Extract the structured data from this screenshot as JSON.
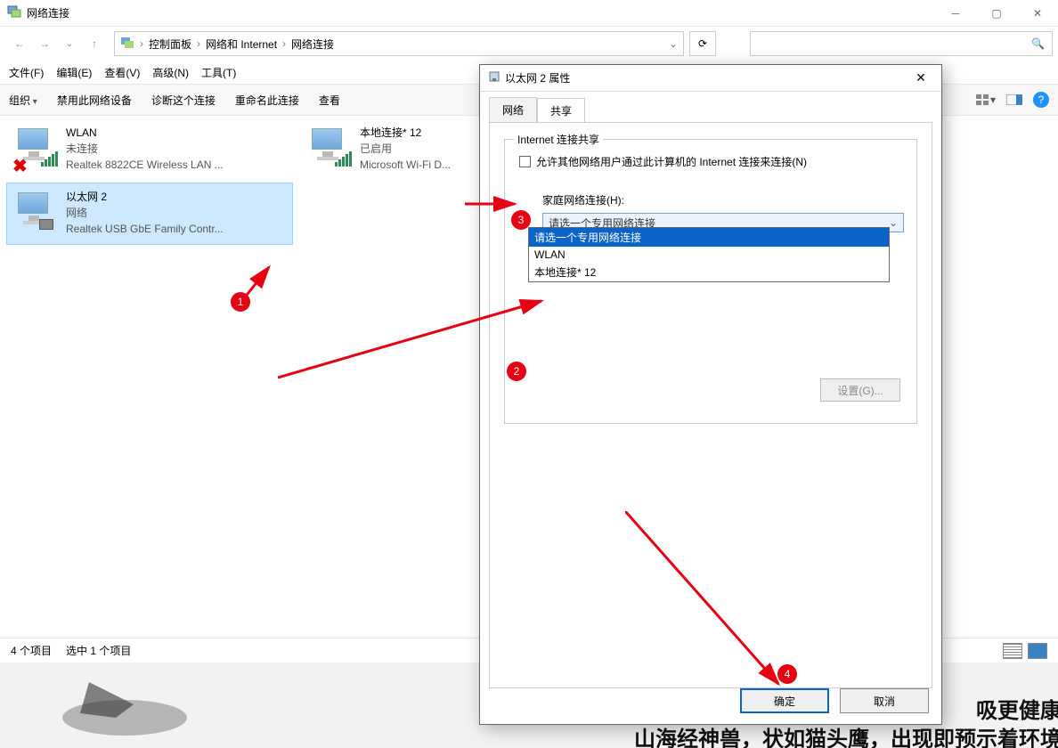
{
  "window": {
    "title": "网络连接",
    "breadcrumb": {
      "a": "控制面板",
      "b": "网络和 Internet",
      "c": "网络连接"
    },
    "menus": {
      "file": "文件(F)",
      "edit": "编辑(E)",
      "view": "查看(V)",
      "advanced": "高级(N)",
      "tools": "工具(T)"
    },
    "toolbar": {
      "organize": "组织",
      "disable": "禁用此网络设备",
      "diagnose": "诊断这个连接",
      "rename": "重命名此连接",
      "view_status": "查看"
    },
    "status": {
      "items": "4 个项目",
      "selected": "选中 1 个项目"
    }
  },
  "connections": [
    {
      "name": "WLAN",
      "status": "未连接",
      "device": "Realtek 8822CE Wireless LAN ..."
    },
    {
      "name": "本地连接* 12",
      "status": "已启用",
      "device": "Microsoft Wi-Fi D..."
    },
    {
      "name": "以太网 2",
      "status": "网络",
      "device": "Realtek USB GbE Family Contr..."
    }
  ],
  "dialog": {
    "title": "以太网 2 属性",
    "tabs": {
      "network": "网络",
      "sharing": "共享"
    },
    "fieldset": "Internet 连接共享",
    "checkbox_label": "允许其他网络用户通过此计算机的 Internet 连接来连接(N)",
    "combo_label": "家庭网络连接(H):",
    "combo_selected": "请选一个专用网络连接",
    "combo_options": {
      "o0": "请选一个专用网络连接",
      "o1": "WLAN",
      "o2": "本地连接* 12"
    },
    "settings_btn": "设置(G)...",
    "ok": "确定",
    "cancel": "取消"
  },
  "annotations": {
    "b1": "1",
    "b2": "2",
    "b3": "3",
    "b4": "4"
  },
  "bg": {
    "line1": "吸更健康",
    "line2": "山海经神兽，状如猫头鹰，出现即预示着环境"
  }
}
